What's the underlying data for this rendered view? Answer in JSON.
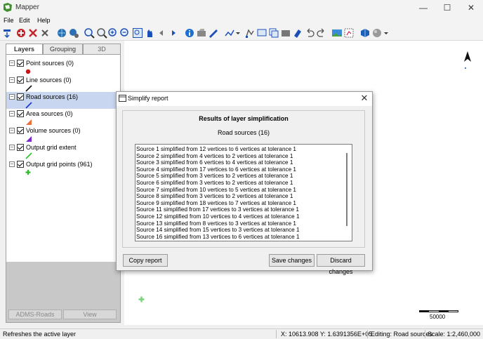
{
  "app": {
    "title": "Mapper"
  },
  "window_controls": {
    "minimize": "—",
    "maximize": "☐",
    "close": "✕"
  },
  "menu": [
    "File",
    "Edit",
    "Help"
  ],
  "tabs": [
    "Layers",
    "Grouping",
    "3D"
  ],
  "layers": [
    {
      "label": "Point sources (0)",
      "symbol": "red-dot",
      "color": "#cc1111"
    },
    {
      "label": "Line sources (0)",
      "symbol": "line",
      "color": "#111111"
    },
    {
      "label": "Road sources (16)",
      "symbol": "line",
      "color": "#1a33cc",
      "selected": true
    },
    {
      "label": "Area sources (0)",
      "symbol": "triangle",
      "color": "#e8703a"
    },
    {
      "label": "Volume sources (0)",
      "symbol": "triangle",
      "color": "#7a2ad0"
    },
    {
      "label": "Output grid extent",
      "symbol": "line",
      "color": "#2bbd2b"
    },
    {
      "label": "Output grid points (961)",
      "symbol": "plus",
      "color": "#2bbd2b"
    }
  ],
  "panel_buttons": {
    "adms_roads": "ADMS-Roads",
    "view": "View"
  },
  "map": {
    "scale_label": "50000"
  },
  "status": {
    "hint": "Refreshes the active layer",
    "coords": "X: 10613.908  Y: 1.6391356E+05",
    "editing": "Editing: Road sources",
    "scale": "Scale: 1:2,460,000"
  },
  "dialog": {
    "title": "Simplify report",
    "heading": "Results of layer simplification",
    "subheading": "Road sources (16)",
    "results": [
      "Source 1 simplified from 12 vertices to 6 vertices at tolerance 1",
      "Source 2 simplified from 4 vertices to 2 vertices at tolerance 1",
      "Source 3 simplified from 6 vertices to 4 vertices at tolerance 1",
      "Source 4 simplified from 17 vertices to 6 vertices at tolerance 1",
      "Source 5 simplified from 3 vertices to 2 vertices at tolerance 1",
      "Source 6 simplified from 3 vertices to 2 vertices at tolerance 1",
      "Source 7 simplified from 10 vertices to 5 vertices at tolerance 1",
      "Source 8 simplified from 3 vertices to 2 vertices at tolerance 1",
      "Source 9 simplified from 18 vertices to 7 vertices at tolerance 1",
      "Source 11 simplified from 17 vertices to 3 vertices at tolerance 1",
      "Source 12 simplified from 10 vertices to 4 vertices at tolerance 1",
      "Source 13 simplified from 8 vertices to 3 vertices at tolerance 1",
      "Source 14 simplified from 15 vertices to 3 vertices at tolerance 1",
      "Source 16 simplified from 13 vertices to 6 vertices at tolerance 1"
    ],
    "buttons": {
      "copy": "Copy report",
      "save": "Save changes",
      "discard": "Discard changes"
    }
  },
  "toolbar_icons": [
    "refresh-icon",
    "add-layer-icon",
    "remove-layer-icon",
    "clear-icon",
    "globe-icon",
    "globe-settings-icon",
    "zoom-extent-icon",
    "zoom-layer-icon",
    "zoom-in-icon",
    "zoom-out-icon",
    "zoom-box-icon",
    "pan-icon",
    "back-icon",
    "forward-icon",
    "info-icon",
    "select-icon",
    "measure-icon",
    "draw-line-icon",
    "dropdown-icon",
    "edit-vertex-icon",
    "move-icon",
    "copy-feature-icon",
    "cut-feature-icon",
    "delete-feature-icon",
    "undo-icon",
    "redo-icon",
    "image-icon",
    "grid-icon",
    "layer-3d-icon",
    "sphere-icon",
    "dropdown-icon"
  ]
}
